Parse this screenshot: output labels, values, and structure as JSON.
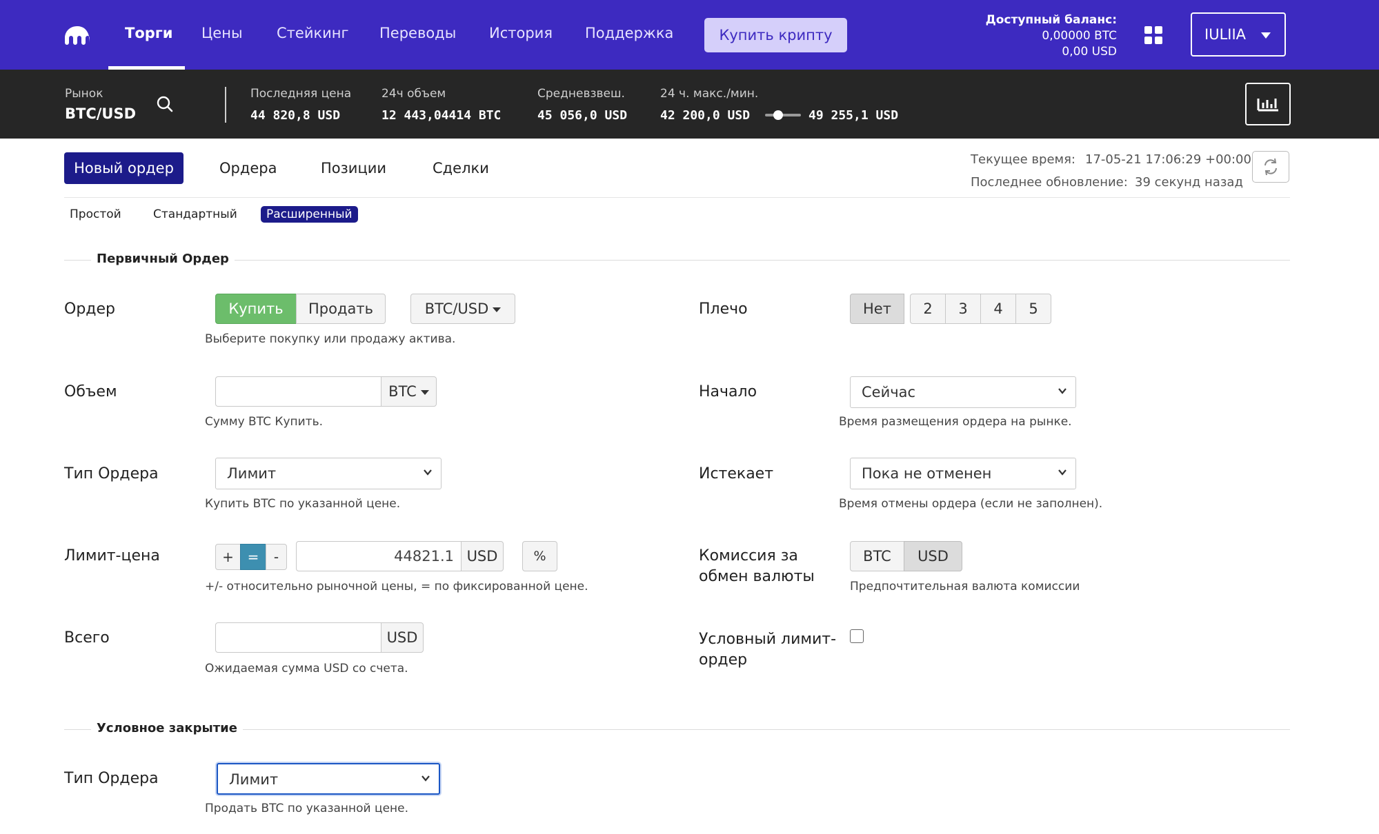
{
  "nav": {
    "items": [
      "Торги",
      "Цены",
      "Стейкинг",
      "Переводы",
      "История",
      "Поддержка"
    ],
    "active": "Торги",
    "buy_crypto": "Купить крипту",
    "balance_label": "Доступный баланс:",
    "balance_btc": "0,00000 BTC",
    "balance_usd": "0,00 USD",
    "user": "IULIIA"
  },
  "market": {
    "pair_label": "Рынок",
    "pair": "BTC/USD",
    "last_price_label": "Последняя цена",
    "last_price": "44 820,8 USD",
    "volume_label": "24ч объем",
    "volume": "12 443,04414 BTC",
    "vwap_label": "Средневзвеш.",
    "vwap": "45 056,0 USD",
    "range_label": "24 ч. макс./мин.",
    "range_low": "42 200,0 USD",
    "range_high": "49 255,1 USD"
  },
  "tabs": {
    "items": [
      "Новый ордер",
      "Ордера",
      "Позиции",
      "Сделки"
    ],
    "active": "Новый ордер"
  },
  "time": {
    "current_label": "Текущее время:",
    "current": "17-05-21 17:06:29 +00:00",
    "updated_label": "Последнее обновление:",
    "updated": "39 секунд назад"
  },
  "subtabs": {
    "items": [
      "Простой",
      "Стандартный",
      "Расширенный"
    ],
    "active": "Расширенный"
  },
  "primary": {
    "title": "Первичный Ордер",
    "order_label": "Ордер",
    "buy": "Купить",
    "sell": "Продать",
    "pair_select": "BTC/USD",
    "order_help": "Выберите покупку или продажу актива.",
    "volume_label": "Объем",
    "volume_value": "",
    "volume_currency": "BTC",
    "volume_help": "Сумму BTC Купить.",
    "order_type_label": "Тип Ордера",
    "order_type": "Лимит",
    "order_type_help": "Купить BTC по указанной цене.",
    "limit_label": "Лимит-цена",
    "plus": "+",
    "equals": "=",
    "minus": "-",
    "limit_value": "44821.1",
    "limit_currency": "USD",
    "percent": "%",
    "limit_help": "+/- относительно рыночной цены, = по фиксированной цене.",
    "total_label": "Всего",
    "total_value": "",
    "total_currency": "USD",
    "total_help": "Ожидаемая сумма USD со счета.",
    "leverage_label": "Плечо",
    "leverage_options": [
      "Нет",
      "2",
      "3",
      "4",
      "5"
    ],
    "leverage_selected": "Нет",
    "start_label": "Начало",
    "start_value": "Сейчас",
    "start_help": "Время размещения ордера на рынке.",
    "expires_label": "Истекает",
    "expires_value": "Пока не отменен",
    "expires_help": "Время отмены ордера (если не заполнен).",
    "fee_label": "Комиссия за обмен валюты",
    "fee_options": [
      "BTC",
      "USD"
    ],
    "fee_selected": "USD",
    "fee_help": "Предпочтительная валюта комиссии",
    "conditional_label": "Условный лимит-ордер",
    "conditional_checked": false
  },
  "close": {
    "title": "Условное закрытие",
    "order_type_label": "Тип Ордера",
    "order_type": "Лимит",
    "order_type_help": "Продать BTC по указанной цене."
  },
  "colors": {
    "nav_bg": "#3d2ac0",
    "market_bg": "#262626",
    "tab_active": "#1c1b8a",
    "buy_green": "#6cbd6b",
    "equals_teal": "#3d8fb0"
  }
}
